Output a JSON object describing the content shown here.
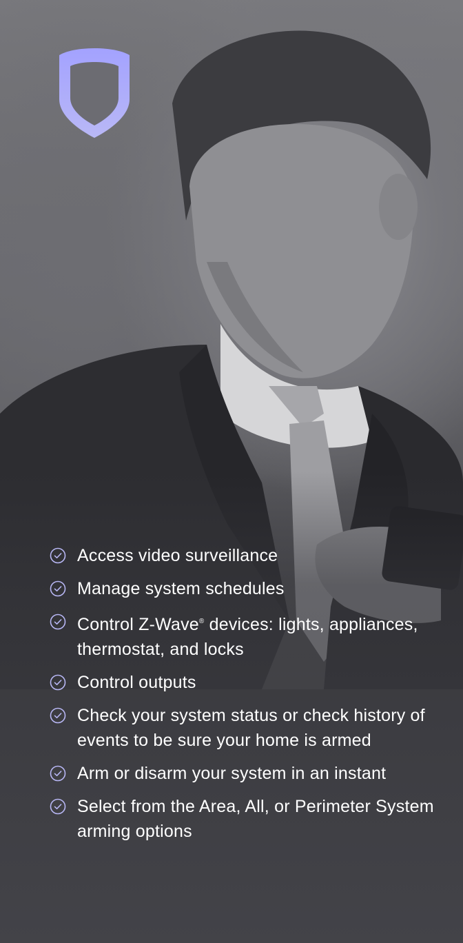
{
  "brand": {
    "logo_icon": "shield-icon",
    "accent_color": "#a9a8ff"
  },
  "features": [
    {
      "icon": "check-circle-icon",
      "text": "Access video surveillance"
    },
    {
      "icon": "check-circle-icon",
      "text_before": "Control Z-Wave",
      "text_mark": "®",
      "text_after": " devices: lights, appliances, thermostat, and locks",
      "text": "Manage system schedules"
    },
    {
      "icon": "check-circle-icon",
      "text": "Control outputs"
    },
    {
      "icon": "check-circle-icon",
      "text": "Check your system status or check history of events to be sure your home is armed"
    },
    {
      "icon": "check-circle-icon",
      "text": "Arm or disarm your system in an instant"
    },
    {
      "icon": "check-circle-icon",
      "text": "Select from the Area, All, or Perimeter System arming options"
    }
  ],
  "feature_zwave": {
    "before": "Control Z-Wave",
    "mark": "®",
    "after": " devices: lights, appliances, thermostat, and locks"
  }
}
